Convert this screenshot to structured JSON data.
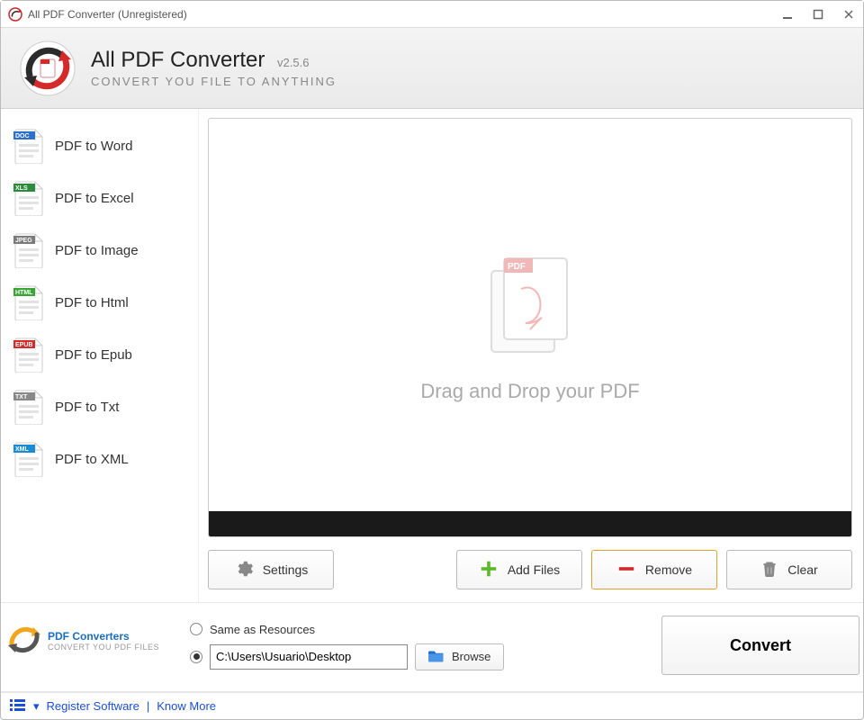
{
  "window": {
    "title": "All PDF Converter (Unregistered)"
  },
  "header": {
    "app_name": "All PDF Converter",
    "version": "v2.5.6",
    "tagline": "Convert You file to anything"
  },
  "sidebar": {
    "items": [
      {
        "label": "PDF to Word",
        "badge": "DOC",
        "badge_color": "#2b6fcc"
      },
      {
        "label": "PDF to Excel",
        "badge": "XLS",
        "badge_color": "#2e8b3d"
      },
      {
        "label": "PDF to Image",
        "badge": "JPEG",
        "badge_color": "#7a7a7a"
      },
      {
        "label": "PDF to Html",
        "badge": "HTML",
        "badge_color": "#3aa537"
      },
      {
        "label": "PDF to Epub",
        "badge": "EPUB",
        "badge_color": "#d42a2a"
      },
      {
        "label": "PDF to Txt",
        "badge": "TXT",
        "badge_color": "#888888"
      },
      {
        "label": "PDF to XML",
        "badge": "XML",
        "badge_color": "#1b8bd6"
      }
    ]
  },
  "dropzone": {
    "hint": "Drag and Drop your PDF"
  },
  "toolbar": {
    "settings": "Settings",
    "add_files": "Add Files",
    "remove": "Remove",
    "clear": "Clear"
  },
  "output": {
    "same_as_resources": "Same as Resources",
    "path": "C:\\Users\\Usuario\\Desktop",
    "browse": "Browse",
    "brand_name": "PDF Converters",
    "brand_tag": "CONVERT YOU PDF FILES"
  },
  "convert": {
    "label": "Convert"
  },
  "statusbar": {
    "register": "Register Software",
    "know_more": "Know More"
  }
}
